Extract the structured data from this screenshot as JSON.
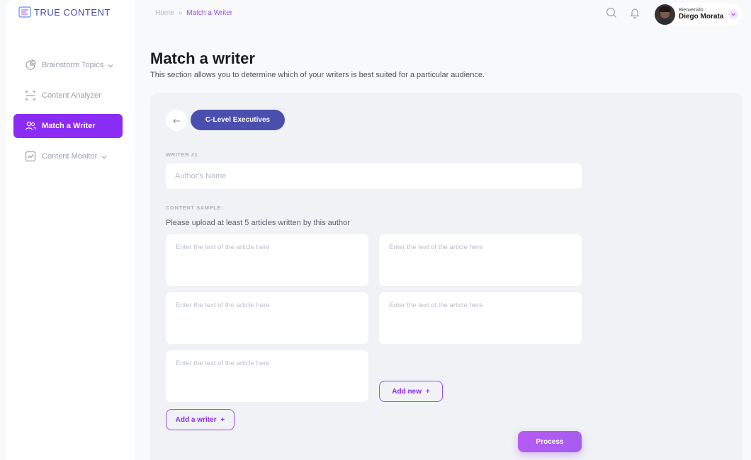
{
  "brand": {
    "name": "TRUE CONTENT",
    "accent": "#8b2cf5",
    "primary": "#4a4fae"
  },
  "sidebar": {
    "items": [
      {
        "label": "Brainstorm Topics",
        "icon": "pie-chart-icon",
        "has_chevron": true,
        "active": false
      },
      {
        "label": "Content Analyzer",
        "icon": "scan-icon",
        "has_chevron": false,
        "active": false
      },
      {
        "label": "Match a Writer",
        "icon": "users-icon",
        "has_chevron": false,
        "active": true
      },
      {
        "label": "Content Monitor",
        "icon": "trend-chart-icon",
        "has_chevron": true,
        "active": false
      }
    ]
  },
  "breadcrumb": {
    "home": "Home",
    "separator": "»",
    "current": "Match a Writer"
  },
  "header": {
    "icons": [
      "search-icon",
      "bell-icon"
    ]
  },
  "user": {
    "greeting": "Bienvenido",
    "name": "Diego Morata"
  },
  "page": {
    "title": "Match a writer",
    "subtitle": "This section allows you to determine which of your writers is best suited for a particular audience."
  },
  "form": {
    "audience": "C-Level Executives",
    "writer_label": "WRITER #1",
    "name_placeholder": "Author's Name",
    "content_label": "CONTENT SAMPLE:",
    "instructions": "Please upload at least 5 articles written by this author",
    "sample_placeholder": "Enter the text of the article here",
    "add_new_label": "Add new",
    "add_writer_label": "Add a writer",
    "plus": "+",
    "process_label": "Process"
  }
}
